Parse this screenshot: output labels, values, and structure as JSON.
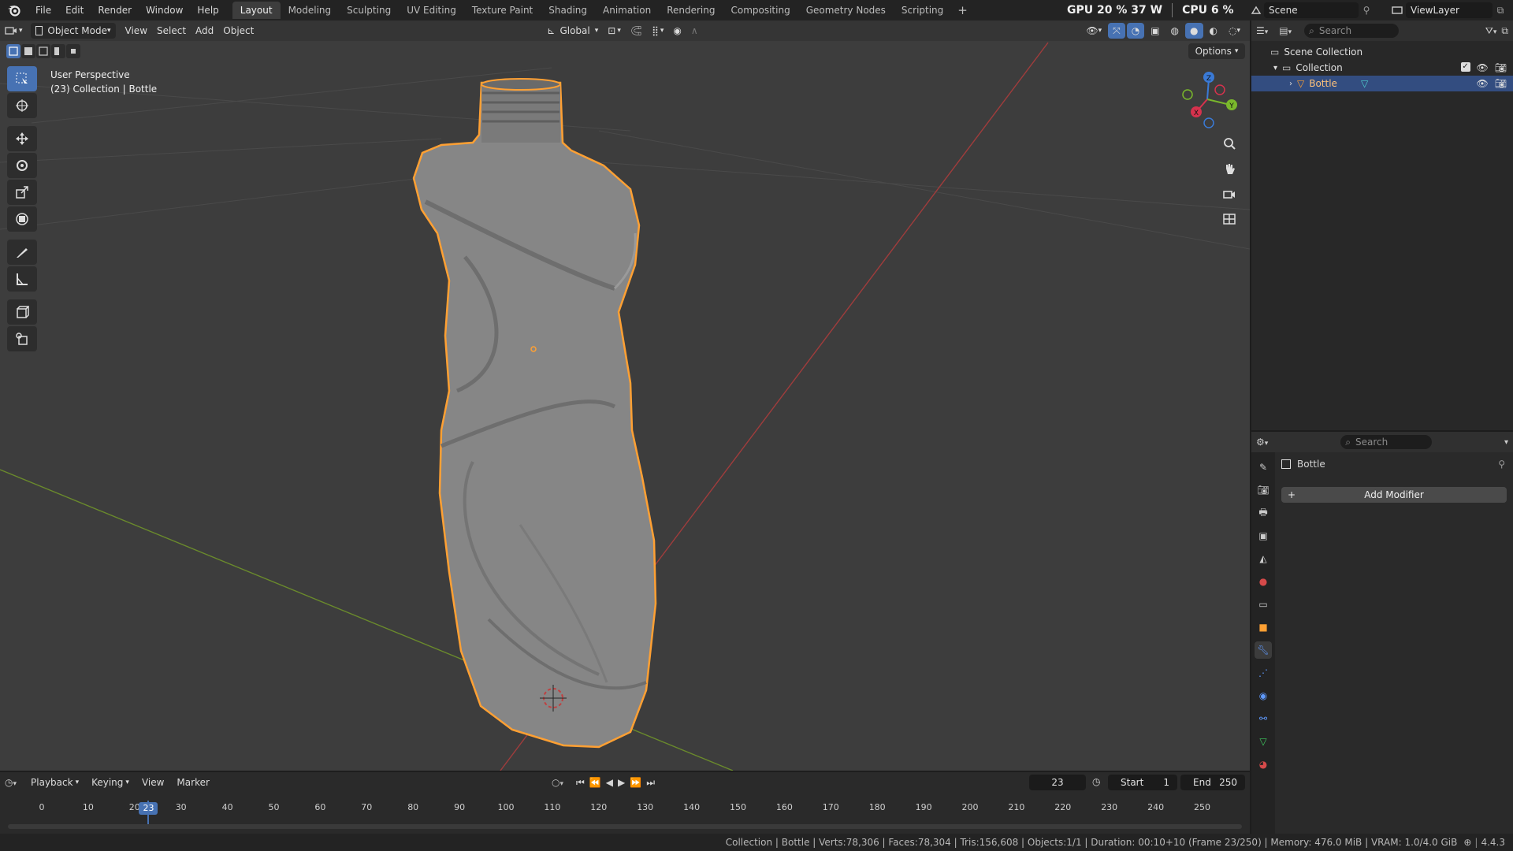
{
  "app": {
    "menus": [
      "File",
      "Edit",
      "Render",
      "Window",
      "Help"
    ]
  },
  "workspace_tabs": [
    "Layout",
    "Modeling",
    "Sculpting",
    "UV Editing",
    "Texture Paint",
    "Shading",
    "Animation",
    "Rendering",
    "Compositing",
    "Geometry Nodes",
    "Scripting"
  ],
  "active_tab": "Layout",
  "stats": {
    "gpu_label": "GPU",
    "gpu_value": "20 %",
    "gpu_power": "37 W",
    "cpu_label": "CPU",
    "cpu_value": "6 %"
  },
  "scene": {
    "name": "Scene",
    "view_layer": "ViewLayer"
  },
  "viewport": {
    "mode": "Object Mode",
    "menus": [
      "View",
      "Select",
      "Add",
      "Object"
    ],
    "transform_orientation": "Global",
    "options_label": "Options",
    "perspective_label": "User Perspective",
    "collection_label": "(23) Collection | Bottle",
    "gizmo_axes": {
      "x": "X",
      "y": "Y",
      "z": "Z"
    },
    "colors": {
      "background": "#3d3d3d",
      "selection_outline": "#ffa033",
      "x_axis": "#a03c3c",
      "y_axis": "#6a8a2c"
    }
  },
  "outliner": {
    "search_placeholder": "Search",
    "scene_collection": "Scene Collection",
    "collection": "Collection",
    "object": "Bottle"
  },
  "properties": {
    "search_placeholder": "Search",
    "object_name": "Bottle",
    "add_modifier": "Add Modifier"
  },
  "timeline": {
    "menus": [
      "Playback",
      "Keying",
      "View",
      "Marker"
    ],
    "current_frame": "23",
    "start_label": "Start",
    "start": "1",
    "end_label": "End",
    "end": "250",
    "ticks": [
      "0",
      "10",
      "20",
      "30",
      "40",
      "50",
      "60",
      "70",
      "80",
      "90",
      "100",
      "110",
      "120",
      "130",
      "140",
      "150",
      "160",
      "170",
      "180",
      "190",
      "200",
      "210",
      "220",
      "230",
      "240",
      "250"
    ]
  },
  "status": {
    "text": "Collection | Bottle | Verts:78,306 | Faces:78,304 | Tris:156,608 | Objects:1/1 | Duration: 00:10+10 (Frame 23/250) | Memory: 476.0 MiB | VRAM: 1.0/4.0 GiB",
    "version": "4.4.3"
  }
}
